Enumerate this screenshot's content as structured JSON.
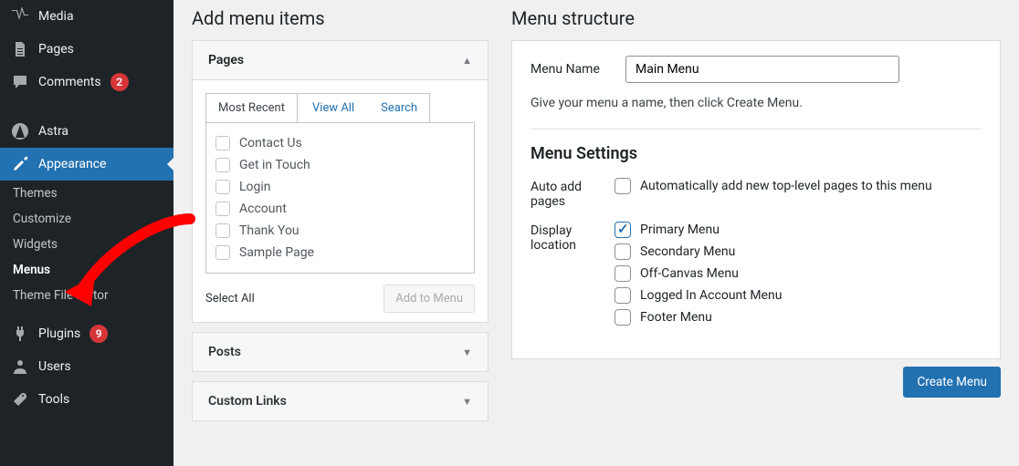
{
  "sidebar": {
    "items": [
      {
        "label": "Media",
        "icon": "media"
      },
      {
        "label": "Pages",
        "icon": "page"
      },
      {
        "label": "Comments",
        "icon": "comment",
        "badge": "2"
      },
      {
        "label": "Astra",
        "icon": "astra"
      },
      {
        "label": "Appearance",
        "icon": "brush",
        "active": true
      },
      {
        "label": "Plugins",
        "icon": "plug",
        "badge": "9"
      },
      {
        "label": "Users",
        "icon": "user"
      },
      {
        "label": "Tools",
        "icon": "wrench"
      }
    ],
    "sub": [
      "Themes",
      "Customize",
      "Widgets",
      "Menus",
      "Theme File Editor"
    ],
    "sub_selected": 3
  },
  "add_items": {
    "title": "Add menu items",
    "panels": [
      {
        "label": "Pages",
        "open": true
      },
      {
        "label": "Posts",
        "open": false
      },
      {
        "label": "Custom Links",
        "open": false
      }
    ],
    "tabs": [
      "Most Recent",
      "View All",
      "Search"
    ],
    "active_tab": 0,
    "pages": [
      "Contact Us",
      "Get in Touch",
      "Login",
      "Account",
      "Thank You",
      "Sample Page"
    ],
    "select_all": "Select All",
    "add_btn": "Add to Menu"
  },
  "structure": {
    "title": "Menu structure",
    "name_label": "Menu Name",
    "name_value": "Main Menu",
    "hint": "Give your menu a name, then click Create Menu.",
    "settings_title": "Menu Settings",
    "auto_add_label": "Auto add pages",
    "auto_add_option": "Automatically add new top-level pages to this menu",
    "display_label": "Display location",
    "locations": [
      "Primary Menu",
      "Secondary Menu",
      "Off-Canvas Menu",
      "Logged In Account Menu",
      "Footer Menu"
    ],
    "locations_checked": [
      true,
      false,
      false,
      false,
      false
    ],
    "create_btn": "Create Menu"
  }
}
